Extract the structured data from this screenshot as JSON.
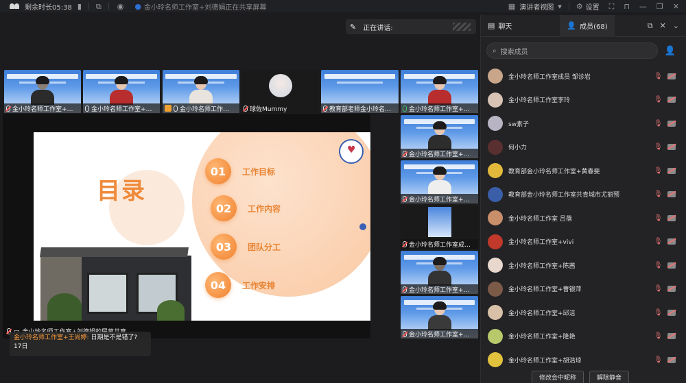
{
  "topbar": {
    "remaining_label": "剩余时长05:38",
    "meeting_title": "金小玲名师工作室+刘德娟正在共享屏幕",
    "view_label": "演讲者视图",
    "settings_label": "设置"
  },
  "speaking": {
    "label": "正在讲话:"
  },
  "tiles": [
    {
      "name": "金小玲名师工作室+…"
    },
    {
      "name": "金小玲名师工作室+…"
    },
    {
      "name": "金小玲名师工作…"
    },
    {
      "name": "球佐Mummy"
    },
    {
      "name": "教育部老师金小玲名…"
    },
    {
      "name": "金小玲名师工作室+…"
    }
  ],
  "side_tiles": [
    {
      "name": "金小玲名师工作室+…"
    },
    {
      "name": "金小玲名师工作室+…"
    },
    {
      "name": "金小玲名师工作室成…"
    },
    {
      "name": "金小玲名师工作室+…"
    },
    {
      "name": "金小玲名师工作室+…"
    }
  ],
  "slide": {
    "title": "目录",
    "items": [
      {
        "num": "01",
        "label": "工作目标"
      },
      {
        "num": "02",
        "label": "工作内容"
      },
      {
        "num": "03",
        "label": "团队分工"
      },
      {
        "num": "04",
        "label": "工作安排"
      }
    ]
  },
  "share": {
    "sharer_label": "金小玲名师工作室+刘德娟的屏幕共享"
  },
  "message": {
    "sender": "金小玲名师工作室+王尚婷:",
    "text": "日期是不是错了?",
    "text2": "17日"
  },
  "panel": {
    "chat_tab": "聊天",
    "members_tab": "成员(68)",
    "search_placeholder": "搜索成员",
    "members": [
      {
        "name": "金小玲名师工作室成员 邹诊岩",
        "avatar_color": "#c9a58a"
      },
      {
        "name": "金小玲名师工作室李玲",
        "avatar_color": "#d8c3b4"
      },
      {
        "name": "sw素子",
        "avatar_color": "#b9b4c4"
      },
      {
        "name": "何小力",
        "avatar_color": "#5a2f2f"
      },
      {
        "name": "教育部金小玲名师工作室+黄春斐",
        "avatar_color": "#e2b93b"
      },
      {
        "name": "教育部金小玲名师工作室共青城市尤丽预",
        "avatar_color": "#3a5fa8"
      },
      {
        "name": "金小玲名师工作室 吕蓓",
        "avatar_color": "#c98e6a"
      },
      {
        "name": "金小玲名师工作室+vivi",
        "avatar_color": "#c0392b"
      },
      {
        "name": "金小玲名师工作室+陈茜",
        "avatar_color": "#e8d7cc"
      },
      {
        "name": "金小玲名师工作室+曹银萍",
        "avatar_color": "#7c5a48"
      },
      {
        "name": "金小玲名师工作室+邱洁",
        "avatar_color": "#d9c0a8"
      },
      {
        "name": "金小玲名师工作室+隆艳",
        "avatar_color": "#b7c96a"
      },
      {
        "name": "金小玲名师工作室+胡浩琼",
        "avatar_color": "#e0c23d"
      }
    ],
    "btn_rename": "修改会中昵称",
    "btn_mute_all": "解除静音"
  }
}
